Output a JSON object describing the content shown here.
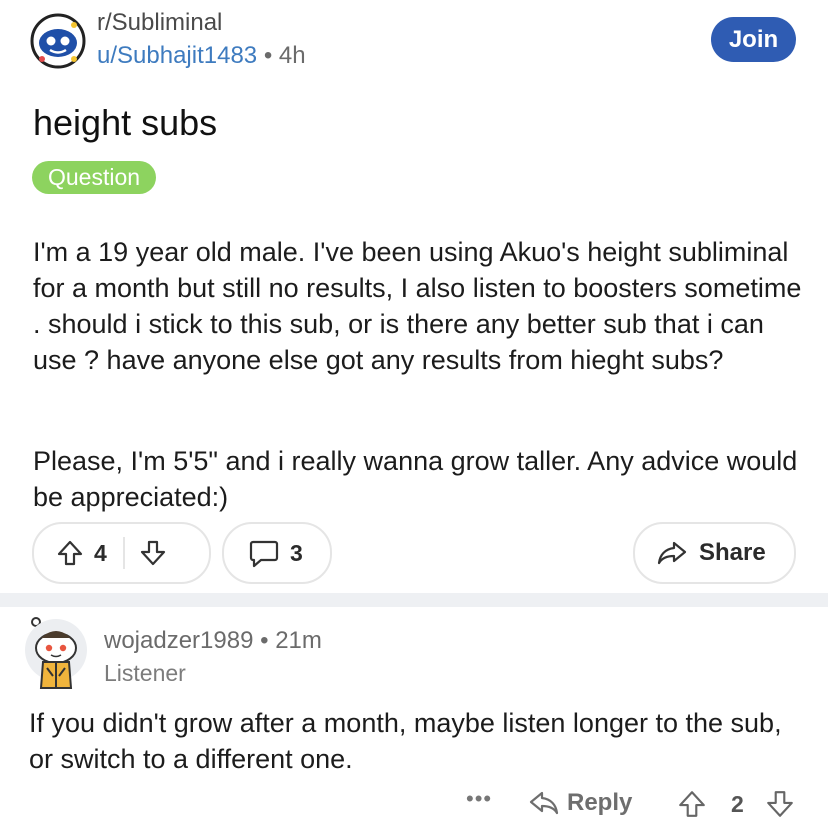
{
  "post": {
    "subreddit": "r/Subliminal",
    "author": "u/Subhajit1483",
    "separator": "•",
    "age": "4h",
    "join_label": "Join",
    "title": "height subs",
    "flair": "Question",
    "body_p1": "I'm a 19 year old male. I've been using Akuo's height subliminal for a month but still no results, I also listen to boosters sometime . should i stick to this sub, or is there any better sub that i can use ? have anyone else got any results from hieght subs?",
    "body_p2": "Please, I'm 5'5\" and i really wanna grow taller. Any advice would be appreciated:)",
    "upvotes": "4",
    "comments": "3",
    "share_label": "Share"
  },
  "comment": {
    "author": "wojadzer1989",
    "separator": "•",
    "age": "21m",
    "flair": "Listener",
    "text": "If you didn't grow after a month, maybe listen longer to the sub, or switch to a different one.",
    "more_label": "•••",
    "reply_label": "Reply",
    "score": "2"
  },
  "colors": {
    "join_bg": "#2f5cb3",
    "flair_bg": "#8dd35f",
    "author_link": "#3e7bbf"
  },
  "icons": [
    "subreddit-avatar",
    "upvote-icon",
    "downvote-icon",
    "comment-icon",
    "share-icon",
    "reply-icon",
    "user-avatar"
  ]
}
